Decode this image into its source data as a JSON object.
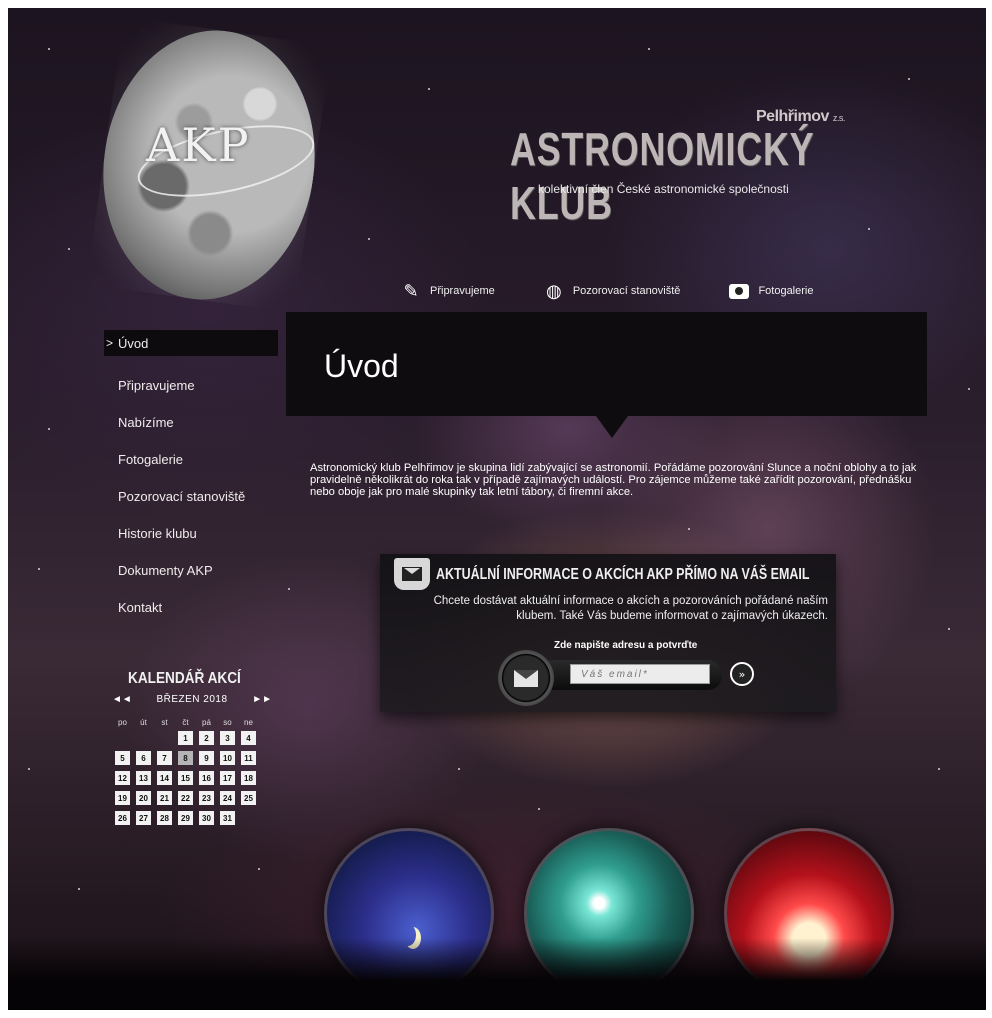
{
  "logo": {
    "text": "AKP"
  },
  "header": {
    "place": "Pelhřimov",
    "place_suffix": "z.s.",
    "title": "ASTRONOMICKÝ KLUB",
    "subtitle": "kolektivní člen České astronomické společnosti"
  },
  "top_nav": [
    {
      "label": "Připravujeme",
      "icon": "pencil-icon"
    },
    {
      "label": "Pozorovací stanoviště",
      "icon": "globe-icon"
    },
    {
      "label": "Fotogalerie",
      "icon": "camera-icon"
    }
  ],
  "side_menu": {
    "active_marker": ">",
    "items": [
      "Úvod",
      "Připravujeme",
      "Nabízíme",
      "Fotogalerie",
      "Pozorovací stanoviště",
      "Historie klubu",
      "Dokumenty AKP",
      "Kontakt"
    ]
  },
  "content": {
    "heading": "Úvod",
    "intro": "Astronomický klub Pelhřimov je skupina lidí zabývající se astronomií. Pořádáme pozorování Slunce a noční oblohy a to jak pravidelně několikrát do roka tak v případě zajímavých událostí. Pro zájemce můžeme také zařídit pozorování, přednášku nebo oboje jak pro malé skupinky tak letní tábory, či firemní akce."
  },
  "newsletter": {
    "title": "AKTUÁLNÍ INFORMACE O AKCÍCH AKP PŘÍMO NA VÁŠ EMAIL",
    "description": "Chcete dostávat aktuální informace o akcích a pozorováních pořádané naším klubem. Také Vás budeme informovat o zajímavých úkazech.",
    "label": "Zde napište adresu a potvrďte",
    "input_placeholder": "Váš email*",
    "submit": "»"
  },
  "calendar": {
    "title": "KALENDÁŘ AKCÍ",
    "prev": "◄◄",
    "next": "►►",
    "month": "BŘEZEN 2018",
    "weekdays": [
      "po",
      "út",
      "st",
      "čt",
      "pá",
      "so",
      "ne"
    ],
    "days": [
      "",
      "",
      "",
      "1",
      "2",
      "3",
      "4",
      "5",
      "6",
      "7",
      "8",
      "9",
      "10",
      "11",
      "12",
      "13",
      "14",
      "15",
      "16",
      "17",
      "18",
      "19",
      "20",
      "21",
      "22",
      "23",
      "24",
      "25",
      "26",
      "27",
      "28",
      "29",
      "30",
      "31"
    ],
    "today": "8"
  }
}
